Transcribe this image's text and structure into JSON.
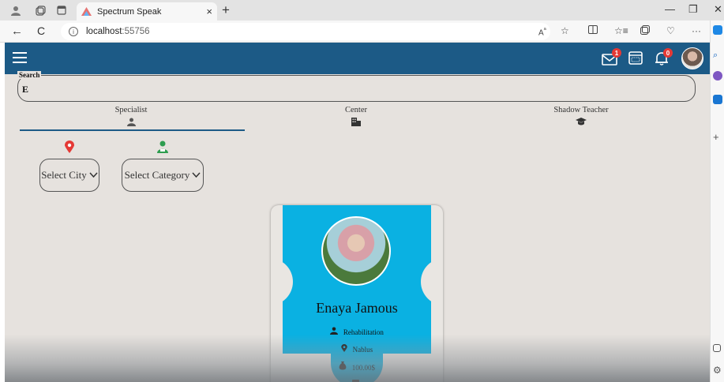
{
  "browser": {
    "tab_title": "Spectrum Speak",
    "tab_close": "×",
    "new_tab": "+",
    "url_host": "localhost",
    "url_port": ":55756",
    "minimize": "—",
    "restore": "❐",
    "close": "✕",
    "back": "←",
    "reload": "C"
  },
  "app": {
    "accent_color": "#1c5a86",
    "card_color": "#0ab1e2",
    "messages_badge": "1",
    "notifications_badge": "0",
    "search": {
      "label": "Search",
      "value": "E"
    },
    "tabs": [
      {
        "label": "Specialist",
        "icon": "user-tie-icon",
        "active": true
      },
      {
        "label": "Center",
        "icon": "building-icon",
        "active": false
      },
      {
        "label": "Shadow Teacher",
        "icon": "graduation-cap-icon",
        "active": false
      }
    ],
    "filters": {
      "city": {
        "icon": "map-pin-icon",
        "value": "Select City"
      },
      "category": {
        "icon": "user-category-icon",
        "value": "Select Category"
      }
    },
    "card": {
      "name": "Enaya Jamous",
      "specialty": "Rehabilitation",
      "city": "Nablus",
      "price": "100.00$"
    }
  }
}
